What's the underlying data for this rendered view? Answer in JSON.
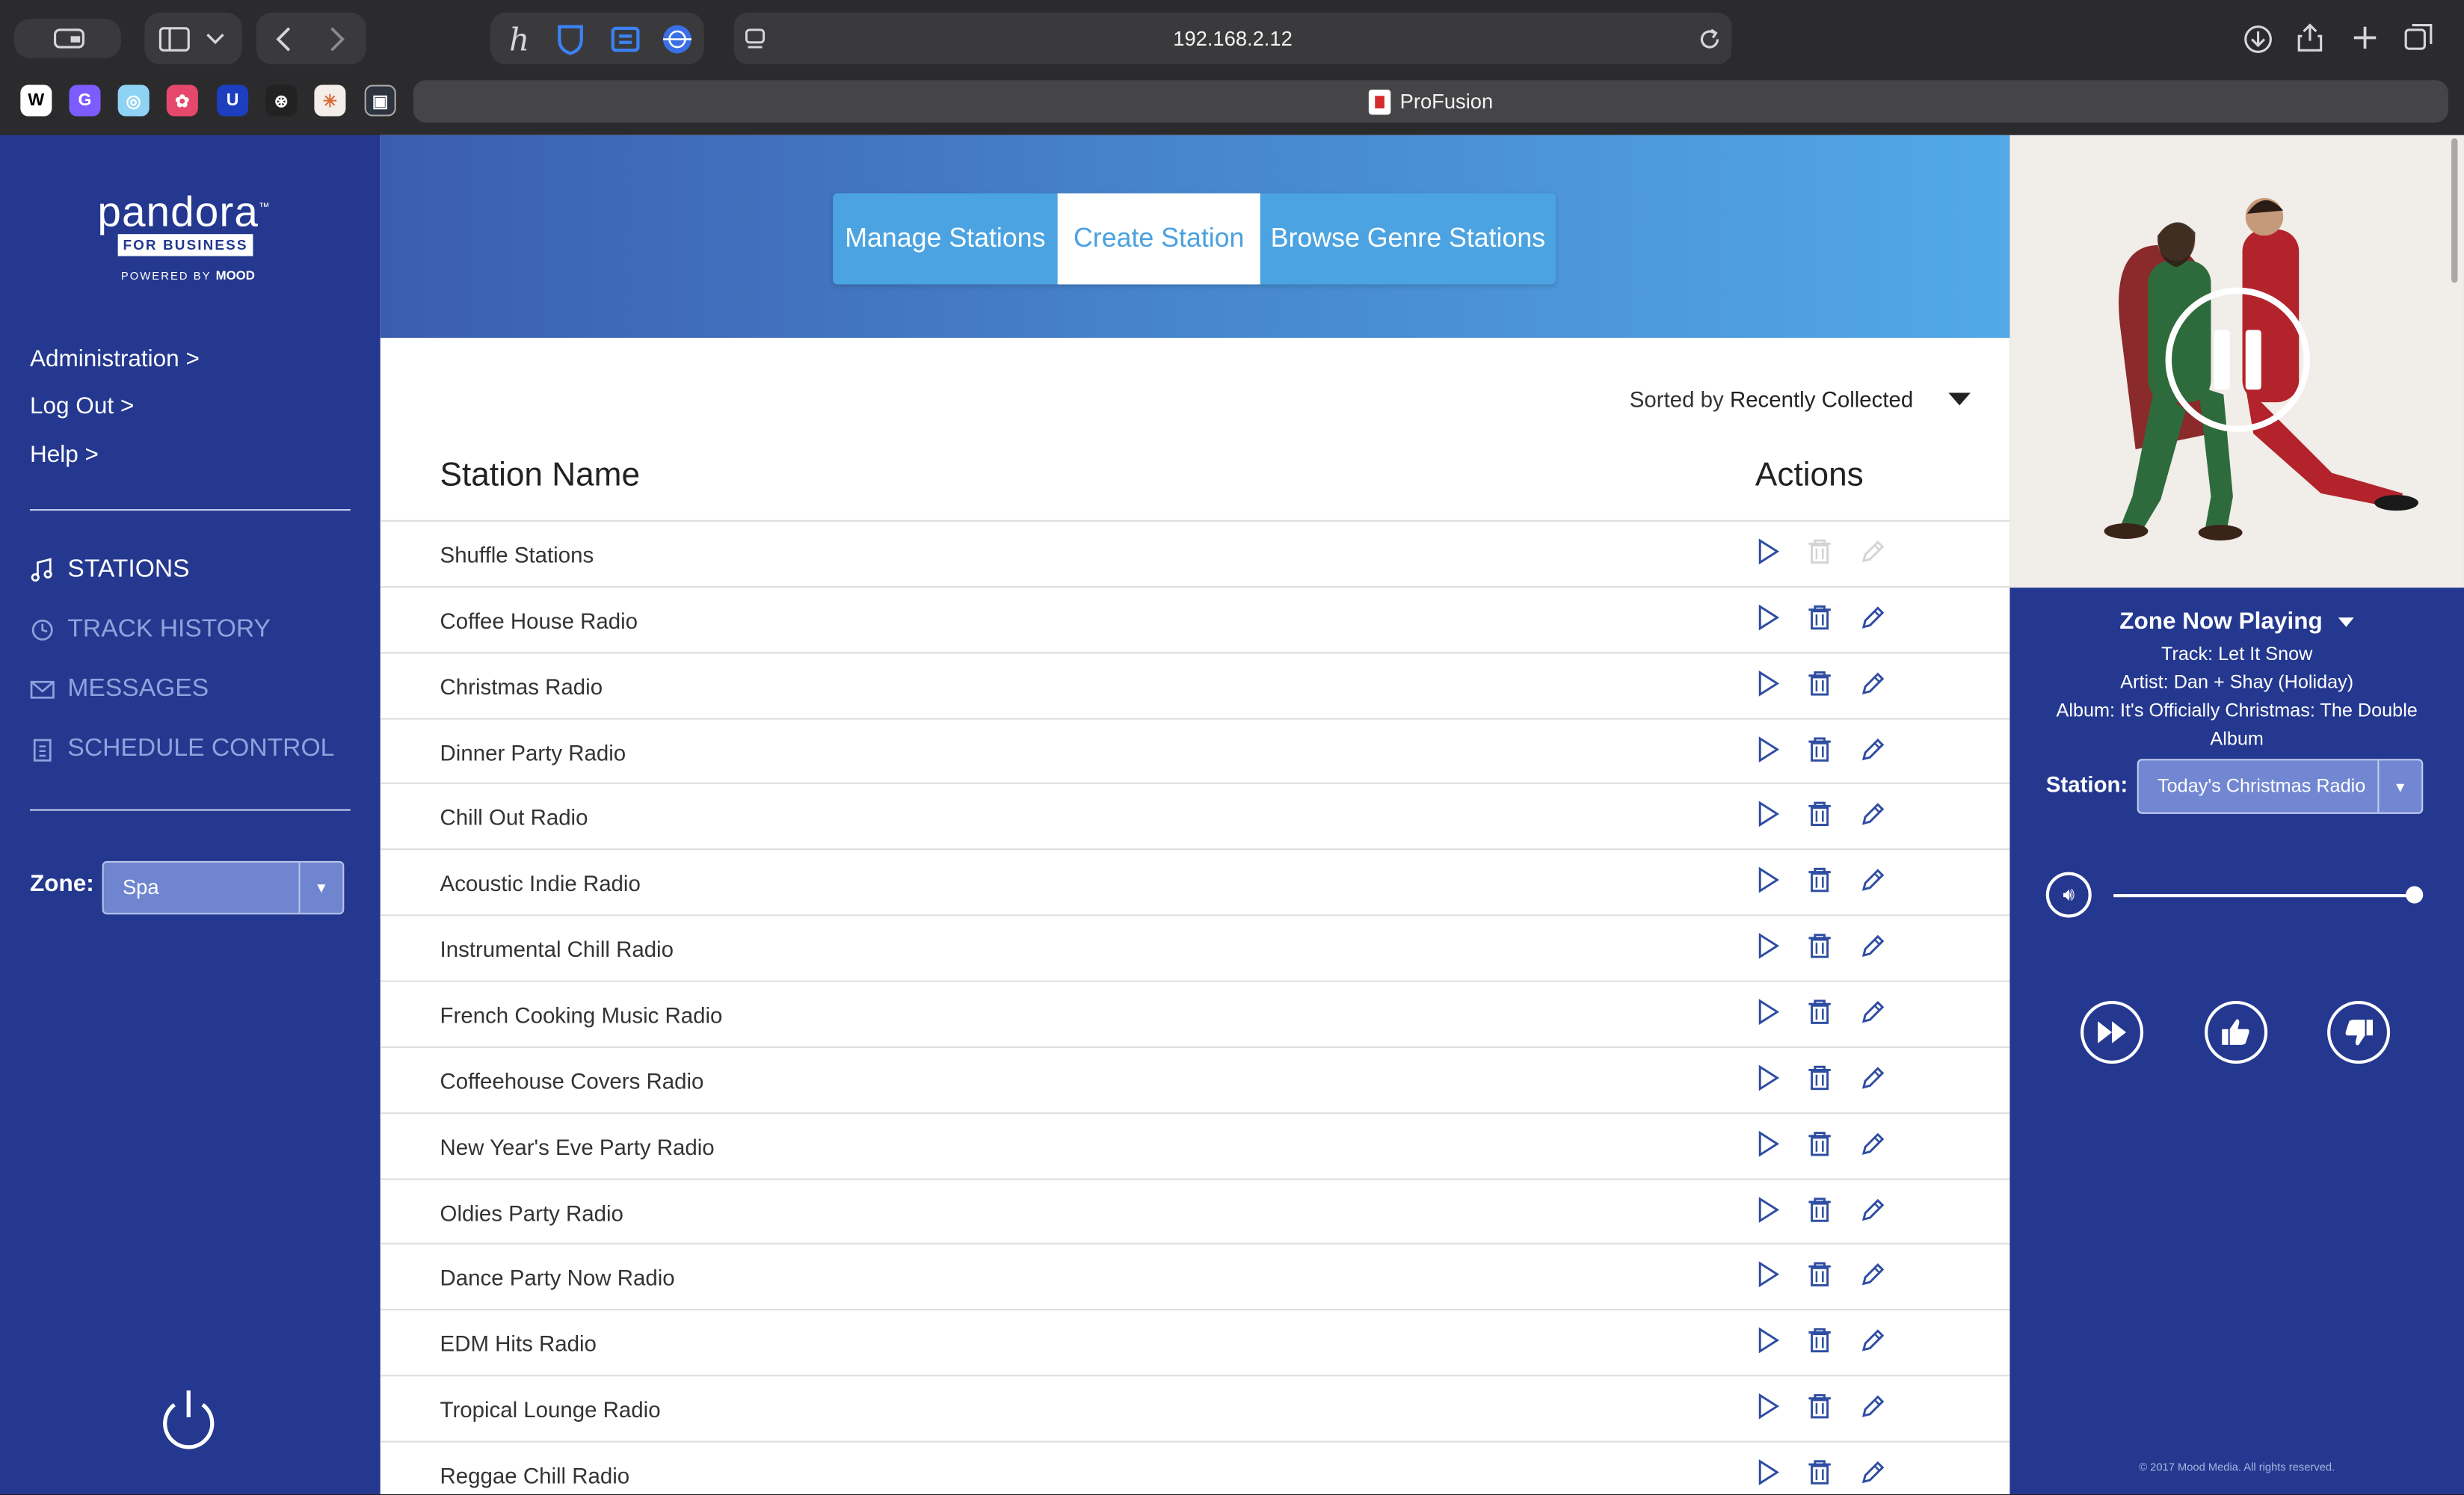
{
  "browser": {
    "url": "192.168.2.12",
    "tab_title": "ProFusion",
    "colors": {
      "chrome": "#2b2b2d",
      "field": "#3a3a3c"
    }
  },
  "sidebar": {
    "logo": {
      "word": "pandora",
      "tm": "™",
      "sub": "FOR BUSINESS",
      "powered": "POWERED BY",
      "mood": "MOOD"
    },
    "links": [
      "Administration >",
      "Log Out >",
      "Help >"
    ],
    "menu": [
      {
        "label": "STATIONS",
        "icon": "music-note-icon",
        "active": true
      },
      {
        "label": "TRACK HISTORY",
        "icon": "history-icon",
        "active": false
      },
      {
        "label": "MESSAGES",
        "icon": "envelope-icon",
        "active": false
      },
      {
        "label": "SCHEDULE CONTROL",
        "icon": "clipboard-icon",
        "active": false
      }
    ],
    "zone_label": "Zone:",
    "zone_value": "Spa"
  },
  "main": {
    "tabs": [
      "Manage Stations",
      "Create Station",
      "Browse Genre Stations"
    ],
    "active_tab": "Create Station",
    "sort_prefix": "Sorted by",
    "sort_value": "Recently Collected",
    "col_name": "Station Name",
    "col_actions": "Actions",
    "stations": [
      "Shuffle Stations",
      "Coffee House Radio",
      "Christmas Radio",
      "Dinner Party Radio",
      "Chill Out Radio",
      "Acoustic Indie Radio",
      "Instrumental Chill Radio",
      "French Cooking Music Radio",
      "Coffeehouse Covers Radio",
      "New Year's Eve Party Radio",
      "Oldies Party Radio",
      "Dance Party Now Radio",
      "EDM Hits Radio",
      "Tropical Lounge Radio",
      "Reggae Chill Radio"
    ]
  },
  "player": {
    "title": "Zone Now Playing",
    "track": "Track: Let It Snow",
    "artist": "Artist: Dan + Shay (Holiday)",
    "album": "Album: It's Officially Christmas: The Double Album",
    "station_label": "Station:",
    "station_value": "Today's Christmas Radio",
    "volume": 1.0,
    "copyright": "© 2017 Mood Media. All rights reserved."
  },
  "colors": {
    "brand_blue": "#24388f",
    "accent": "#4aa1df"
  }
}
